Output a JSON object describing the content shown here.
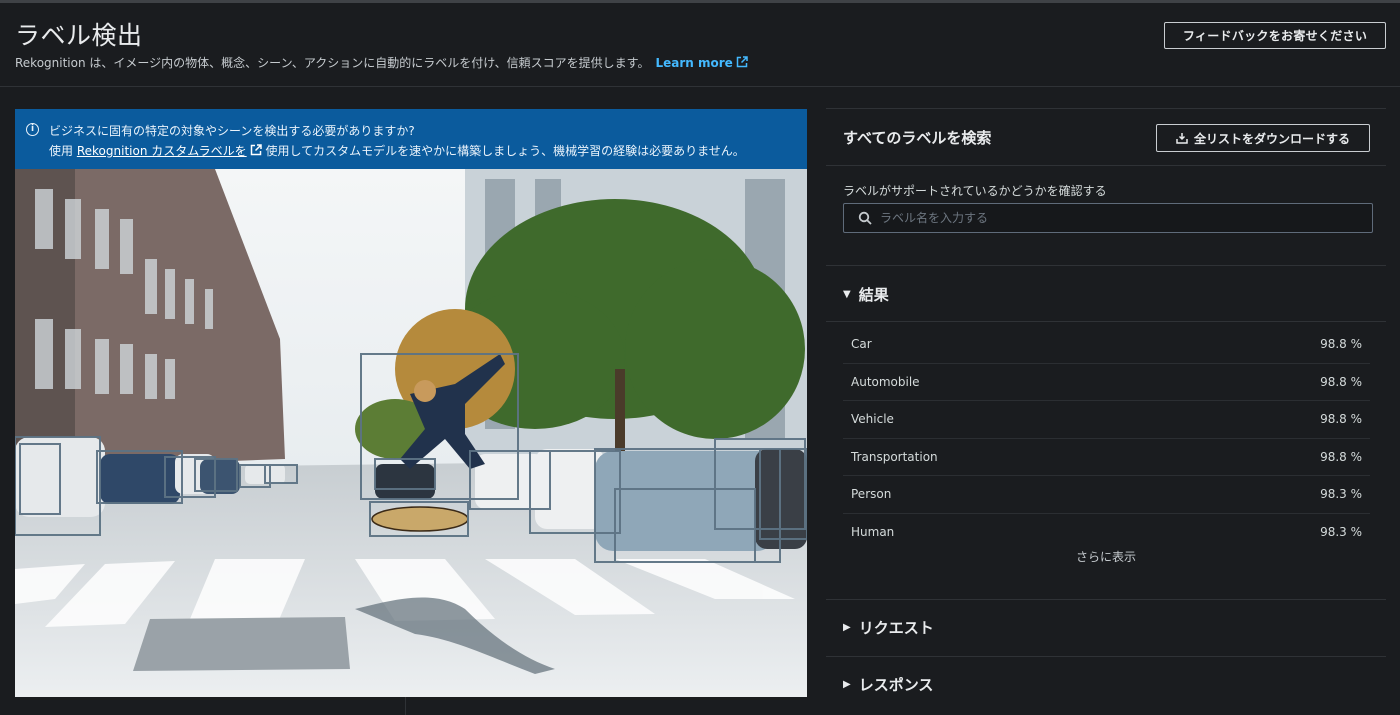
{
  "header": {
    "title": "ラベル検出",
    "description": "Rekognition は、イメージ内の物体、概念、シーン、アクションに自動的にラベルを付け、信頼スコアを提供します。",
    "learn_more": "Learn more",
    "feedback_label": "フィードバックをお寄せください"
  },
  "banner": {
    "line1": "ビジネスに固有の特定の対象やシーンを検出する必要がありますか?",
    "line2_prefix": "使用",
    "line2_link": "Rekognition カスタムラベルを",
    "line2_suffix": "使用してカスタムモデルを速やかに構築しましょう、機械学習の経験は必要ありません。"
  },
  "search": {
    "title": "すべてのラベルを検索",
    "download_label": "全リストをダウンロードする",
    "check_label": "ラベルがサポートされているかどうかを確認する",
    "placeholder": "ラベル名を入力する"
  },
  "results": {
    "title": "結果",
    "items": [
      {
        "label": "Car",
        "score": "98.8 %"
      },
      {
        "label": "Automobile",
        "score": "98.8 %"
      },
      {
        "label": "Vehicle",
        "score": "98.8 %"
      },
      {
        "label": "Transportation",
        "score": "98.8 %"
      },
      {
        "label": "Person",
        "score": "98.3 %"
      },
      {
        "label": "Human",
        "score": "98.3 %"
      }
    ],
    "show_more": "さらに表示"
  },
  "sections": {
    "request": "リクエスト",
    "response": "レスポンス"
  },
  "icons": {
    "info": "info-icon",
    "external": "external-link-icon",
    "download": "download-icon",
    "search": "search-icon",
    "caret_down": "caret-down-icon",
    "caret_right": "caret-right-icon"
  },
  "colors": {
    "accent_link": "#44b9ff",
    "banner_bg": "#0b5b9d",
    "page_bg": "#1a1c1f"
  }
}
